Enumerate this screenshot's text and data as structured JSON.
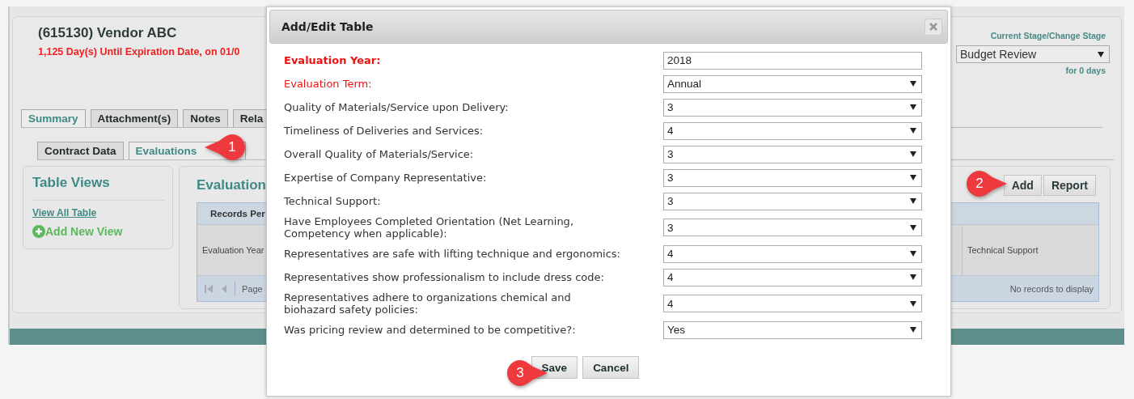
{
  "header": {
    "title": "(615130) Vendor ABC",
    "expiration": "1,125 Day(s) Until Expiration Date, on 01/0",
    "stage_label": "Current Stage/Change Stage",
    "stage": "Budget Review",
    "stage_duration": "for 0 days"
  },
  "tabs": [
    {
      "label": "Summary",
      "selected": true
    },
    {
      "label": "Attachment(s)",
      "selected": false
    },
    {
      "label": "Notes",
      "selected": false
    },
    {
      "label": "Rela",
      "selected": false
    }
  ],
  "subtabs": [
    {
      "label": "Contract Data",
      "selected": false
    },
    {
      "label": "Evaluations",
      "selected": true
    }
  ],
  "table_views": {
    "title": "Table Views",
    "link": "View All Table",
    "add_view": "Add New View"
  },
  "evaluations": {
    "title": "Evaluation",
    "buttons": [
      "Add",
      "Report"
    ],
    "grid_header": "Records Per",
    "columns": [
      "Evaluation Year",
      "Technical Support"
    ],
    "pager_label": "Page",
    "empty_message": "No records to display"
  },
  "dialog": {
    "title": "Add/Edit Table",
    "fields": [
      {
        "label": "Evaluation Year:",
        "kind": "text",
        "value": "2018",
        "required": true,
        "bold": true
      },
      {
        "label": "Evaluation Term:",
        "kind": "select",
        "value": "Annual",
        "required": true,
        "bold": false
      },
      {
        "label": "Quality of Materials/Service upon Delivery:",
        "kind": "select",
        "value": "3",
        "required": false,
        "bold": false
      },
      {
        "label": "Timeliness of Deliveries and Services:",
        "kind": "select",
        "value": "4",
        "required": false,
        "bold": false
      },
      {
        "label": "Overall Quality of Materials/Service:",
        "kind": "select",
        "value": "3",
        "required": false,
        "bold": false
      },
      {
        "label": "Expertise of Company Representative:",
        "kind": "select",
        "value": "3",
        "required": false,
        "bold": false
      },
      {
        "label": "Technical Support:",
        "kind": "select",
        "value": "3",
        "required": false,
        "bold": false
      },
      {
        "label": "Have Employees Completed Orientation (Net Learning,\nCompetency when applicable):",
        "kind": "select",
        "value": "3",
        "required": false,
        "bold": false
      },
      {
        "label": "Representatives are safe with lifting technique and ergonomics:",
        "kind": "select",
        "value": "4",
        "required": false,
        "bold": false
      },
      {
        "label": "Representatives show professionalism to include dress code:",
        "kind": "select",
        "value": "4",
        "required": false,
        "bold": false
      },
      {
        "label": "Representatives adhere to organizations chemical and\nbiohazard safety policies:",
        "kind": "select",
        "value": "4",
        "required": false,
        "bold": false
      },
      {
        "label": "Was pricing review and determined to be competitive?:",
        "kind": "select",
        "value": "Yes",
        "required": false,
        "bold": false
      }
    ],
    "buttons": [
      "Save",
      "Cancel"
    ]
  },
  "callouts": [
    {
      "number": "1"
    },
    {
      "number": "2"
    },
    {
      "number": "3"
    }
  ]
}
